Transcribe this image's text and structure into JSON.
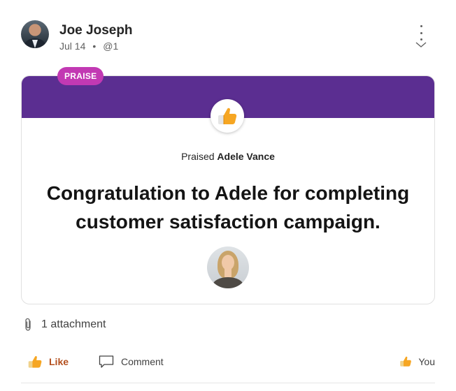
{
  "post": {
    "author": "Joe Joseph",
    "date": "Jul 14",
    "separator": "•",
    "mention": "@1"
  },
  "praise": {
    "badge": "PRAISE",
    "praised_prefix": "Praised",
    "recipient": "Adele Vance",
    "message": "Congratulation to Adele for completing customer satisfaction campaign."
  },
  "attachment": {
    "label": "1 attachment"
  },
  "actions": {
    "like_label": "Like",
    "comment_label": "Comment",
    "reactor_label": "You"
  },
  "colors": {
    "band": "#5b2e91",
    "badge": "#c239b3",
    "like": "#b4501f",
    "thumb": "#f6a623"
  },
  "icons": {
    "menu": "more-vertical-icon",
    "expand": "chevron-down-icon",
    "praise": "thumbs-up-icon",
    "attachment": "paperclip-icon",
    "like": "thumbs-up-icon",
    "comment": "comment-icon",
    "reaction": "thumbs-up-icon"
  }
}
